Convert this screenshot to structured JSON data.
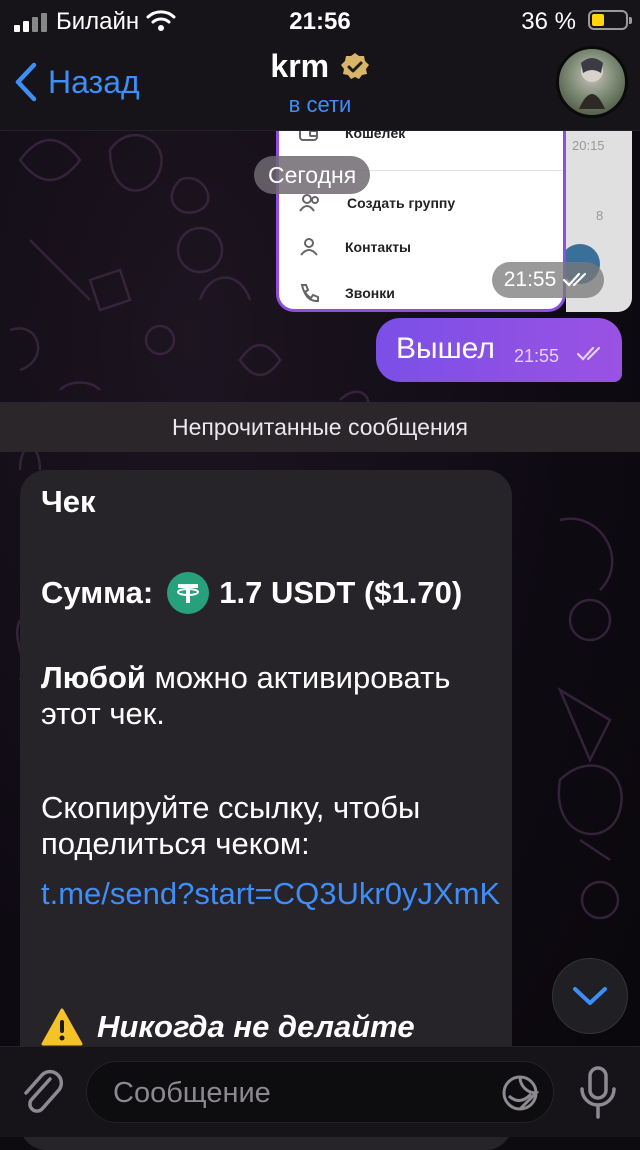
{
  "status_bar": {
    "carrier": "Билайн",
    "time": "21:56",
    "battery_percent": "36 %",
    "battery_level": 0.36
  },
  "nav": {
    "back_label": "Назад",
    "chat_name": "krm",
    "chat_status": "в сети"
  },
  "image_message": {
    "menu_items": [
      "Кошелёк",
      "Создать группу",
      "Контакты",
      "Звонки"
    ],
    "strip_times": [
      "20:15",
      "8"
    ],
    "time": "21:55"
  },
  "date_chip": "Сегодня",
  "outgoing_message": {
    "text": "Вышел",
    "time": "21:55"
  },
  "unread_label": "Непрочитанные сообщения",
  "check_message": {
    "title": "Чек",
    "sum_label": "Сумма:",
    "sum_value": "1.7 USDT ($1.70)",
    "any_bold": "Любой",
    "any_rest": " можно активировать этот чек.",
    "copy_text": "Скопируйте ссылку, чтобы поделиться чеком:",
    "link": "t.me/send?start=CQ3Ukr0yJXmK",
    "warning": "Никогда не делайте"
  },
  "input": {
    "placeholder": "Сообщение"
  },
  "colors": {
    "accent": "#3e8ef7",
    "outgoing_bubble": "#8a50e5",
    "incoming_bubble": "#262329",
    "usdt": "#26a17b"
  },
  "icons": [
    "signal-icon",
    "wifi-icon",
    "battery-icon",
    "back-chevron-icon",
    "verified-icon",
    "wallet-icon",
    "group-icon",
    "contact-icon",
    "phone-icon",
    "read-ticks-icon",
    "usdt-icon",
    "warning-icon",
    "chevron-down-icon",
    "paperclip-icon",
    "sticker-icon",
    "microphone-icon"
  ]
}
